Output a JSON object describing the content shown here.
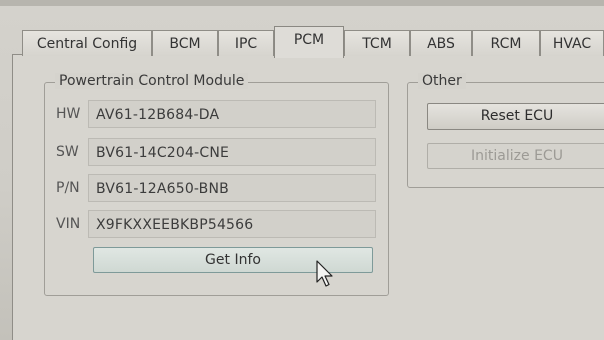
{
  "tabs": [
    {
      "label": "Central Config",
      "active": false
    },
    {
      "label": "BCM",
      "active": false
    },
    {
      "label": "IPC",
      "active": false
    },
    {
      "label": "PCM",
      "active": true
    },
    {
      "label": "TCM",
      "active": false
    },
    {
      "label": "ABS",
      "active": false
    },
    {
      "label": "RCM",
      "active": false
    },
    {
      "label": "HVAC",
      "active": false
    }
  ],
  "pcm_group": {
    "legend": "Powertrain Control Module",
    "rows": [
      {
        "label": "HW",
        "value": "AV61-12B684-DA"
      },
      {
        "label": "SW",
        "value": "BV61-14C204-CNE"
      },
      {
        "label": "P/N",
        "value": "BV61-12A650-BNB"
      },
      {
        "label": "VIN",
        "value": "X9FKXXEEBKBP54566"
      }
    ],
    "get_info_label": "Get Info"
  },
  "other_group": {
    "legend": "Other",
    "reset_label": "Reset ECU",
    "initialize_label": "Initialize ECU",
    "initialize_enabled": false
  }
}
